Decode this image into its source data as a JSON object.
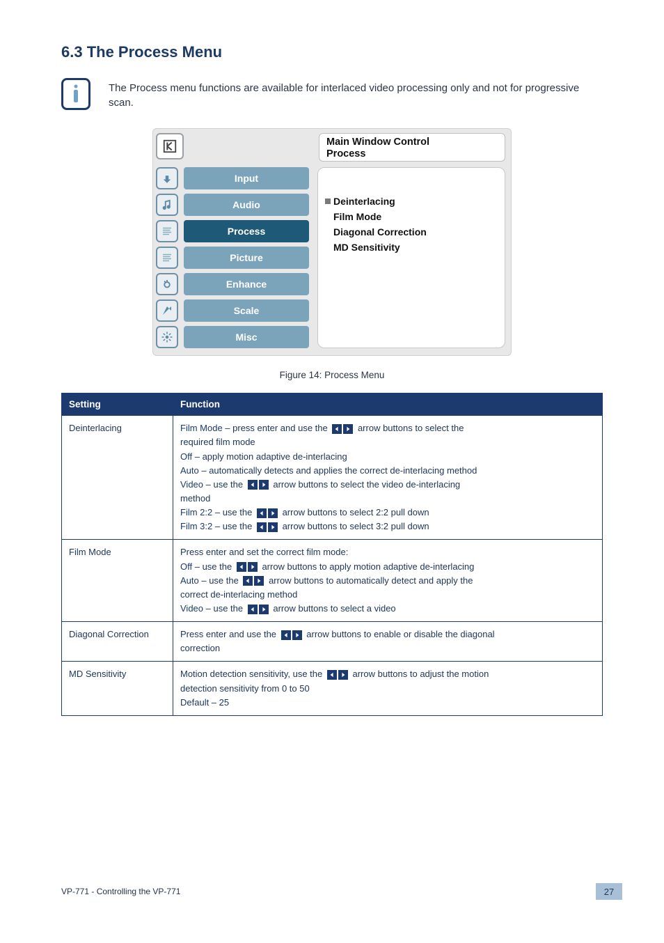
{
  "section_title": "6.3 The Process Menu",
  "intro_text": "The Process menu functions are available for interlaced video processing only and not for progressive scan.",
  "osd": {
    "title_line1": "Main Window Control",
    "title_line2": "Process",
    "menu": [
      {
        "label": "Input",
        "active": false
      },
      {
        "label": "Audio",
        "active": false
      },
      {
        "label": "Process",
        "active": true
      },
      {
        "label": "Picture",
        "active": false
      },
      {
        "label": "Enhance",
        "active": false
      },
      {
        "label": "Scale",
        "active": false
      },
      {
        "label": "Misc",
        "active": false
      }
    ],
    "panel": {
      "heading": "Deinterlacing",
      "items": [
        "Film Mode",
        "Diagonal Correction",
        "MD Sensitivity"
      ]
    }
  },
  "figure_caption": "Figure 14: Process Menu",
  "table": {
    "headers": [
      "Setting",
      "Function"
    ],
    "rows": [
      {
        "setting": "Deinterlacing",
        "lines": [
          {
            "label": "Film Mode",
            "sep": " – press enter and use the ",
            "arrows": true,
            "tail": " arrow buttons to select the"
          },
          {
            "plain": "required film mode"
          },
          {
            "label": "Off",
            "sep": " – apply motion adaptive de-interlacing"
          },
          {
            "label": "Auto",
            "sep": " – automatically detects and applies the correct de-interlacing method"
          },
          {
            "label": "Video",
            "sep": " – use the ",
            "arrows": true,
            "tail": " arrow buttons to select the video de-interlacing"
          },
          {
            "plain": "method"
          },
          {
            "label": "Film 2:2",
            "sep": " – use the ",
            "arrows": true,
            "tail": " arrow buttons to select 2:2 pull down"
          },
          {
            "label": "Film 3:2",
            "sep": " – use the ",
            "arrows": true,
            "tail": " arrow buttons to select 3:2 pull down"
          }
        ]
      },
      {
        "setting": "Film Mode",
        "lines": [
          {
            "plain": "Press enter and set the correct film mode:"
          },
          {
            "label": "Off",
            "sep": " – use the ",
            "arrows": true,
            "tail": " arrow buttons to apply motion adaptive de-interlacing"
          },
          {
            "label": "Auto",
            "sep": " – use the ",
            "arrows": true,
            "tail": " arrow buttons to automatically detect and apply the"
          },
          {
            "plain": "correct de-interlacing method"
          },
          {
            "label": "Video",
            "sep": " – use the ",
            "arrows": true,
            "tail": " arrow buttons to select a video"
          }
        ]
      },
      {
        "setting": "Diagonal Correction",
        "lines": [
          {
            "plain_pre": "Press enter and use the ",
            "arrows": true,
            "tail": " arrow buttons to enable or disable the diagonal"
          },
          {
            "plain": "correction"
          }
        ]
      },
      {
        "setting": "MD Sensitivity",
        "lines": [
          {
            "plain_pre": "Motion detection sensitivity, use the ",
            "arrows": true,
            "tail": " arrow buttons to adjust the motion"
          },
          {
            "plain": "detection sensitivity from 0 to 50"
          },
          {
            "plain": "Default – 25"
          }
        ]
      }
    ]
  },
  "footer_text": "VP-771 - Controlling the VP-771",
  "page_number": "27"
}
